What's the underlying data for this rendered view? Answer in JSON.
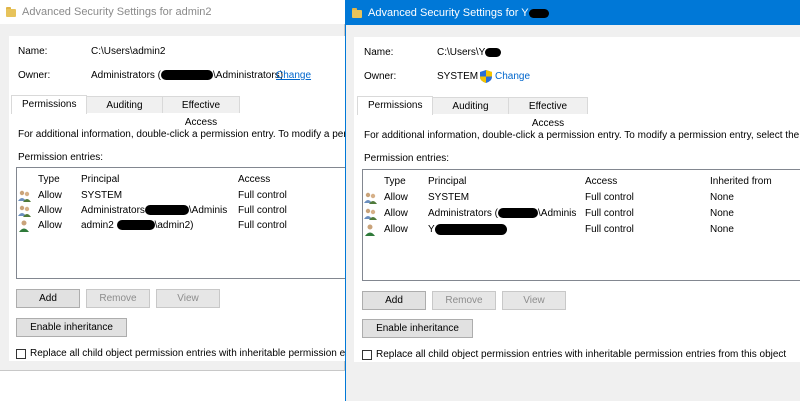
{
  "left": {
    "title": "Advanced Security Settings for admin2",
    "name_label": "Name:",
    "name_value": "C:\\Users\\admin2",
    "owner_label": "Owner:",
    "owner_prefix": "Administrators (",
    "owner_suffix": "\\Administrators)",
    "change_link": "Change",
    "tabs": [
      "Permissions",
      "Auditing",
      "Effective Access"
    ],
    "info_text": "For additional information, double-click a permission entry. To modify a per",
    "entries_label": "Permission entries:",
    "headers": [
      "Type",
      "Principal",
      "Access"
    ],
    "rows": [
      {
        "icon": "group-icon",
        "type": "Allow",
        "principal_a": "SYSTEM",
        "principal_b": "",
        "access": "Full control"
      },
      {
        "icon": "group-icon",
        "type": "Allow",
        "principal_a": "Administrators",
        "principal_b": "\\Adminis",
        "access": "Full control"
      },
      {
        "icon": "user-icon",
        "type": "Allow",
        "principal_a": "admin2",
        "principal_b": "\\admin2)",
        "access": "Full control"
      }
    ],
    "buttons": {
      "add": "Add",
      "remove": "Remove",
      "view": "View"
    },
    "enable_inheritance": "Enable inheritance",
    "replace_text": "Replace all child object permission entries with inheritable permission ent"
  },
  "right": {
    "title_prefix": "Advanced Security Settings for Y",
    "name_label": "Name:",
    "name_value": "C:\\Users\\Y",
    "owner_label": "Owner:",
    "owner_value": "SYSTEM",
    "change_link": "Change",
    "tabs": [
      "Permissions",
      "Auditing",
      "Effective Access"
    ],
    "info_text": "For additional information, double-click a permission entry. To modify a permission entry, select the e",
    "entries_label": "Permission entries:",
    "headers": [
      "Type",
      "Principal",
      "Access",
      "Inherited from"
    ],
    "rows": [
      {
        "icon": "group-icon",
        "type": "Allow",
        "principal_a": "SYSTEM",
        "principal_b": "",
        "access": "Full control",
        "inherited": "None"
      },
      {
        "icon": "group-icon",
        "type": "Allow",
        "principal_a": "Administrators (",
        "principal_b": "\\Adminis",
        "access": "Full control",
        "inherited": "None"
      },
      {
        "icon": "user-icon",
        "type": "Allow",
        "principal_a": "Y",
        "principal_b": "",
        "access": "Full control",
        "inherited": "None"
      }
    ],
    "buttons": {
      "add": "Add",
      "remove": "Remove",
      "view": "View"
    },
    "enable_inheritance": "Enable inheritance",
    "replace_text": "Replace all child object permission entries with inheritable permission entries from this object"
  },
  "colors": {
    "accent": "#0078d7",
    "link": "#0066cc",
    "panel": "#f0f0f0"
  }
}
